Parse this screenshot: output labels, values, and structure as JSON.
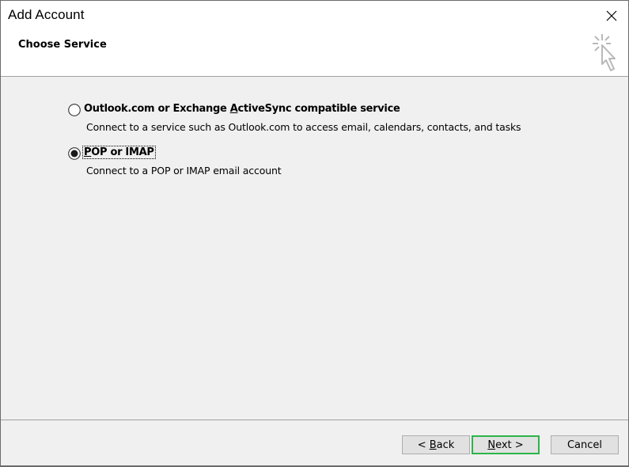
{
  "window": {
    "title": "Add Account",
    "close_icon": "close-icon"
  },
  "header": {
    "subtitle": "Choose Service",
    "wizard_icon": "cursor-sparkle-icon"
  },
  "options": [
    {
      "label_pre": "Outlook.com or Exchange ",
      "label_accel": "A",
      "label_post": "ctiveSync compatible service",
      "description": "Connect to a service such as Outlook.com to access email, calendars, contacts, and tasks",
      "selected": false
    },
    {
      "label_pre": "",
      "label_accel": "P",
      "label_post": "OP or IMAP",
      "description": "Connect to a POP or IMAP email account",
      "selected": true
    }
  ],
  "buttons": {
    "back_pre": "< ",
    "back_accel": "B",
    "back_post": "ack",
    "next_accel": "N",
    "next_post": "ext >",
    "cancel": "Cancel"
  },
  "colors": {
    "default_button_border": "#2bb44a",
    "dialog_background": "#f0f0f0",
    "header_background": "#ffffff"
  }
}
